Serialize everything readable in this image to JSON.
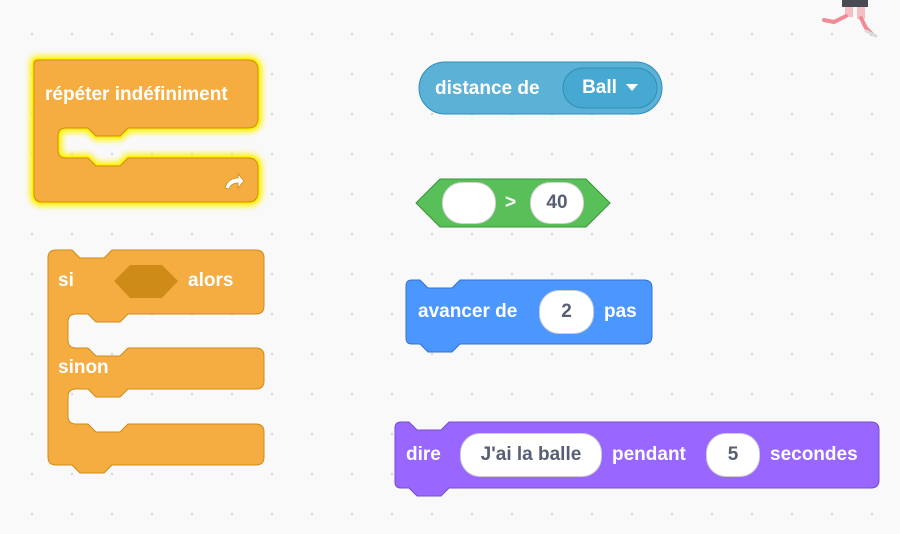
{
  "colors": {
    "control": "#f5ac40",
    "sensing": "#5cb1d6",
    "operators": "#59c059",
    "motion": "#4c97ff",
    "looks": "#9966ff",
    "glow": "#fff200"
  },
  "blocks": {
    "forever": {
      "label": "répéter indéfiniment",
      "icon": "loop-arrow-icon"
    },
    "if_else": {
      "if_label": "si",
      "then_label": "alors",
      "else_label": "sinon"
    },
    "distance": {
      "label": "distance de",
      "target": "Ball"
    },
    "greater_than": {
      "left": "",
      "op": ">",
      "right": "40"
    },
    "move": {
      "label": "avancer de",
      "steps": "2",
      "unit": "pas"
    },
    "say_for": {
      "label": "dire",
      "message": "J'ai la balle",
      "middle": "pendant",
      "seconds": "5",
      "unit": "secondes"
    }
  }
}
